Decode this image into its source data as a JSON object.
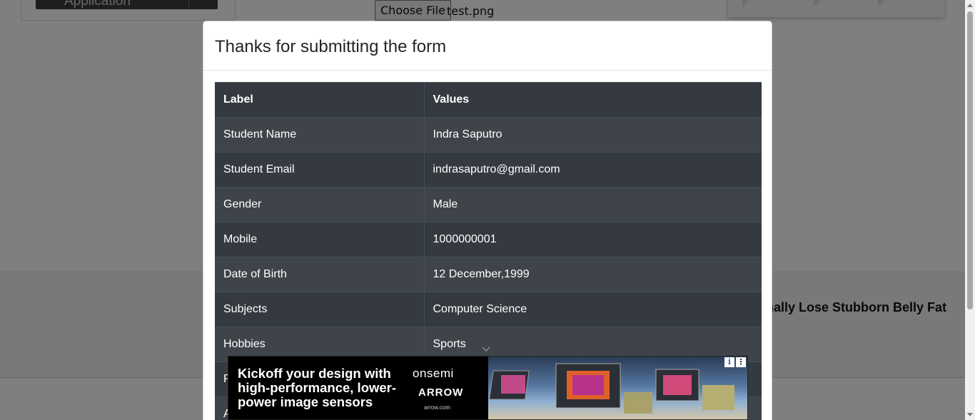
{
  "background": {
    "sidebar_button_label": "Application",
    "file_button_label": "Choose File",
    "file_name": "test.png",
    "band_headline": "inally Lose Stubborn Belly Fat"
  },
  "modal": {
    "title": "Thanks for submitting the form",
    "table": {
      "headers": [
        "Label",
        "Values"
      ],
      "rows": [
        {
          "label": "Student Name",
          "value": "Indra Saputro"
        },
        {
          "label": "Student Email",
          "value": "indrasaputro@gmail.com"
        },
        {
          "label": "Gender",
          "value": "Male"
        },
        {
          "label": "Mobile",
          "value": "1000000001"
        },
        {
          "label": "Date of Birth",
          "value": "12 December,1999"
        },
        {
          "label": "Subjects",
          "value": "Computer Science"
        },
        {
          "label": "Hobbies",
          "value": "Sports"
        },
        {
          "label": "P",
          "value": ""
        },
        {
          "label": "A",
          "value": ""
        }
      ]
    }
  },
  "ad": {
    "headline": "Kickoff your design with high-performance, lower-power image sensors",
    "brand_primary": "onsemi",
    "brand_secondary": "ARROW",
    "url": "arrow.com",
    "info_icon": "info-icon",
    "menu_icon": "kebab-menu-icon"
  },
  "colors": {
    "table_bg": "#343a40",
    "table_stripe": "#3e444a",
    "overlay": "rgba(0,0,0,0.5)"
  }
}
